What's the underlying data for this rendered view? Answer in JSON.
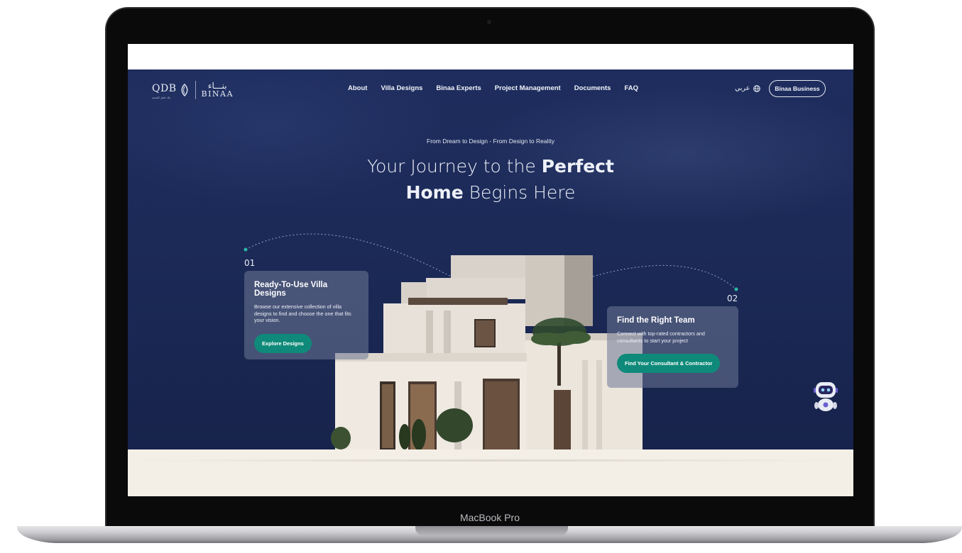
{
  "device": {
    "label": "MacBook Pro"
  },
  "logo": {
    "qdb": "QDB",
    "qdb_sub": "بنك قطر للتنمية",
    "binaa_ar": "بنـــاء",
    "binaa": "BINAA"
  },
  "nav": {
    "links": [
      "About",
      "Villa Designs",
      "Binaa Experts",
      "Project Management",
      "Documents",
      "FAQ"
    ],
    "language": "عربي",
    "business_button": "Binaa Business"
  },
  "hero": {
    "tagline": "From Dream to Design - From Design to Reality",
    "headline_pre": "Your Journey to the ",
    "headline_bold1": "Perfect",
    "headline_bold2": "Home",
    "headline_post": " Begins Here"
  },
  "steps": [
    {
      "number": "01",
      "title": "Ready-To-Use Villa Designs",
      "description": "Browse our extensive collection of villa designs to find and choose the one that fits your vision.",
      "button": "Explore Designs"
    },
    {
      "number": "02",
      "title": "Find the Right Team",
      "description": "Connect with top-rated contractors and consultants to start your project",
      "button": "Find Your Consultant & Contractor"
    }
  ],
  "colors": {
    "hero_bg": "#1e2d5e",
    "accent": "#0f8a7a",
    "footer_bg": "#f3efe6"
  },
  "icons": {
    "language": "globe-icon",
    "assistant": "chatbot-robot-icon"
  }
}
